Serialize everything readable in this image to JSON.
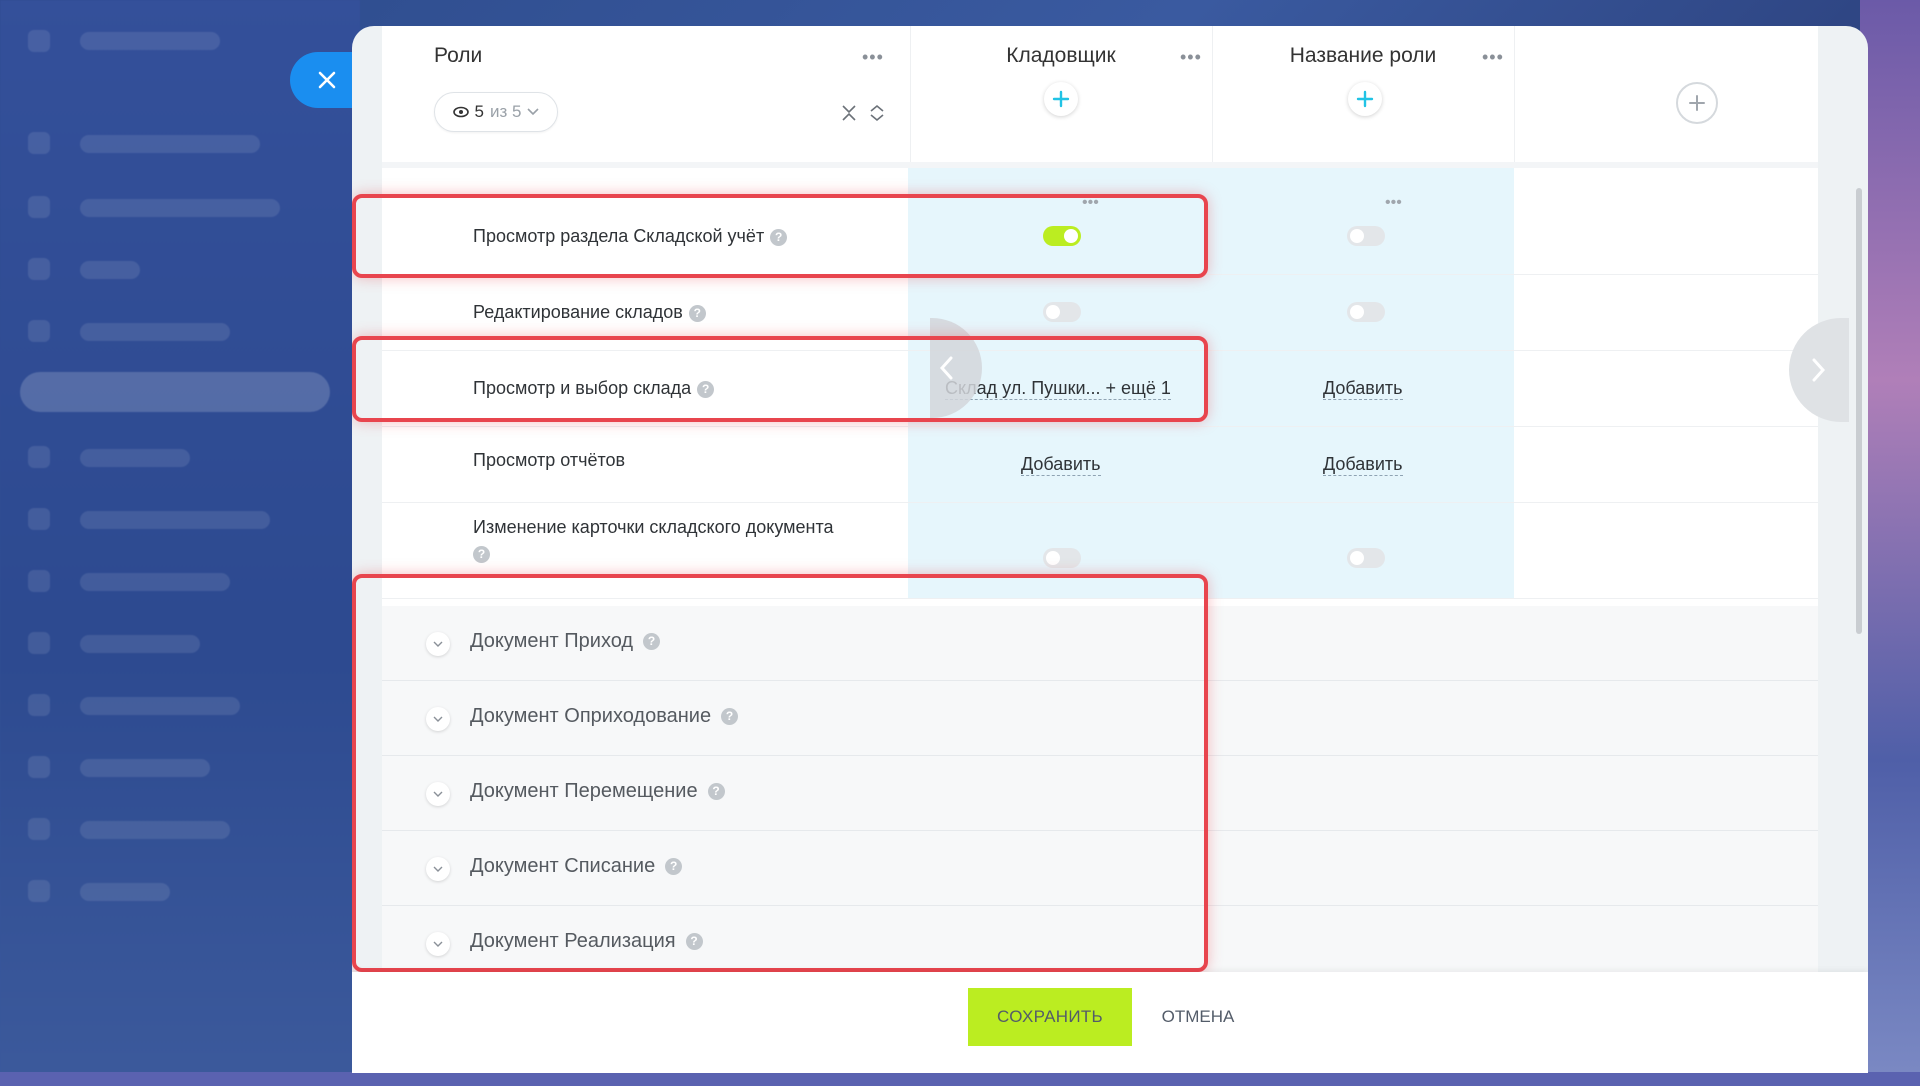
{
  "header": {
    "roles_title": "Роли",
    "visible_count": "5",
    "visible_of": "из 5",
    "roles": [
      {
        "name": "Кладовщик"
      },
      {
        "name": "Название роли"
      }
    ]
  },
  "rows": [
    {
      "label": "Просмотр раздела Складской учёт",
      "values": [
        {
          "type": "toggle",
          "on": true
        },
        {
          "type": "toggle",
          "on": false
        }
      ]
    },
    {
      "label": "Редактирование складов",
      "values": [
        {
          "type": "toggle",
          "on": false
        },
        {
          "type": "toggle",
          "on": false
        }
      ]
    },
    {
      "label": "Просмотр и выбор склада",
      "values": [
        {
          "type": "link",
          "text": "Склад ул. Пушки... + ещё 1"
        },
        {
          "type": "link",
          "text": "Добавить"
        }
      ]
    },
    {
      "label": "Просмотр отчётов",
      "values": [
        {
          "type": "link",
          "text": "Добавить"
        },
        {
          "type": "link",
          "text": "Добавить"
        }
      ]
    },
    {
      "label": "Изменение карточки складского документа",
      "values": [
        {
          "type": "toggle",
          "on": false
        },
        {
          "type": "toggle",
          "on": false
        }
      ]
    }
  ],
  "sections": [
    "Документ Приход",
    "Документ Оприходование",
    "Документ Перемещение",
    "Документ Списание",
    "Документ Реализация"
  ],
  "footer": {
    "save_label": "СОХРАНИТЬ",
    "cancel_label": "ОТМЕНА"
  },
  "colors": {
    "accent_green": "#bbed21",
    "close_blue": "#1a8ef0",
    "highlight_red": "#e8454e",
    "plus_cyan": "#21c3e5"
  },
  "icons": {
    "close": "close-icon",
    "eye": "eye-icon",
    "collapse": "collapse-icon",
    "expand": "expand-icon",
    "plus": "plus-icon",
    "more": "more-dots-icon",
    "chevron": "chevron-down-icon",
    "help": "question-icon"
  }
}
